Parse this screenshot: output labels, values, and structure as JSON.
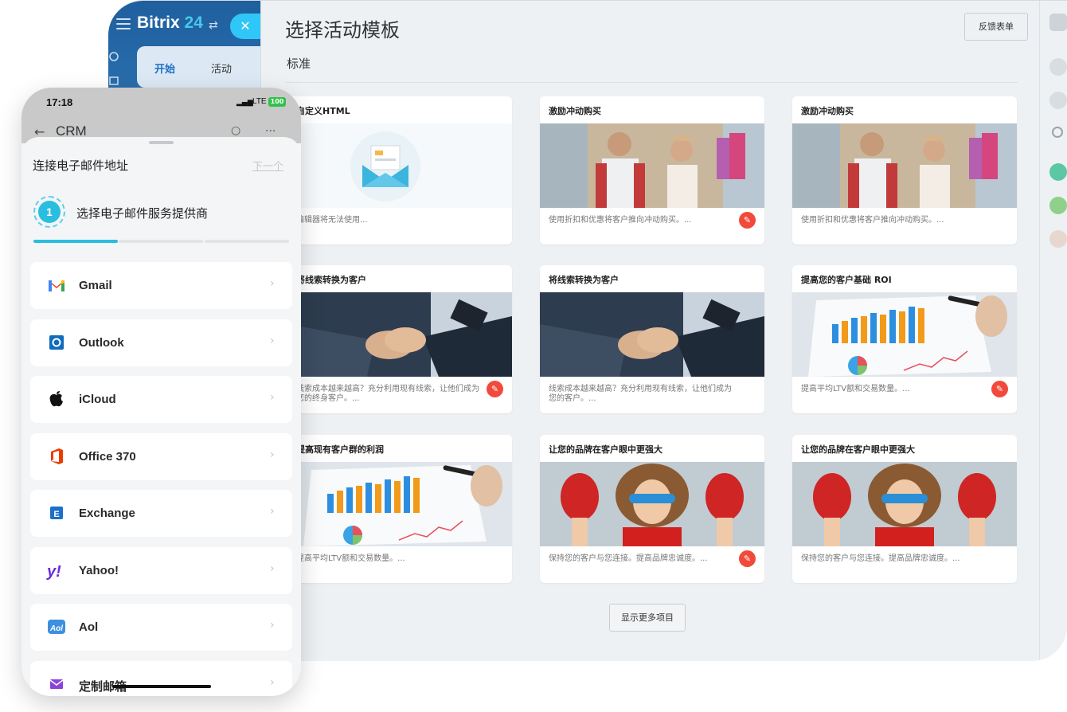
{
  "desktop": {
    "logo_text": "Bitrix",
    "logo_number": "24",
    "tabs": [
      {
        "label": "开始"
      },
      {
        "label": "活动"
      }
    ]
  },
  "panel": {
    "title": "选择活动模板",
    "feedback_label": "反馈表单",
    "section_label": "标准",
    "show_more_label": "显示更多项目",
    "cards": [
      {
        "title": "自定义HTML",
        "desc": "编辑器将无法使用...",
        "brush": false,
        "image": "mail"
      },
      {
        "title": "激励冲动购买",
        "desc": "使用折扣和优惠将客户推向冲动购买。...",
        "brush": true,
        "image": "couple"
      },
      {
        "title": "激励冲动购买",
        "desc": "使用折扣和优惠将客户推向冲动购买。...",
        "brush": false,
        "image": "couple"
      },
      {
        "title": "将线索转换为客户",
        "desc": "线索成本越来越高？充分利用现有线索，让他们成为您的终身客户。...",
        "brush": true,
        "image": "hands"
      },
      {
        "title": "将线索转换为客户",
        "desc": "线索成本越来越高？充分利用现有线索，让他们成为您的客户。...",
        "brush": false,
        "image": "hands"
      },
      {
        "title": "提高您的客户基础 ROI",
        "desc": "提高平均LTV额和交易数量。...",
        "brush": true,
        "image": "chart"
      },
      {
        "title": "提高现有客户群的利润",
        "desc": "提高平均LTV额和交易数量。...",
        "brush": false,
        "image": "chart"
      },
      {
        "title": "让您的品牌在客户眼中更强大",
        "desc": "保持您的客户与您连接。提高品牌忠诚度。...",
        "brush": true,
        "image": "kid"
      },
      {
        "title": "让您的品牌在客户眼中更强大",
        "desc": "保持您的客户与您连接。提高品牌忠诚度。...",
        "brush": false,
        "image": "kid"
      }
    ]
  },
  "phone": {
    "time": "17:18",
    "network": "LTE",
    "battery": "100",
    "app_title": "CRM",
    "sheet_title": "连接电子邮件地址",
    "next_label": "下一个",
    "step_number": "1",
    "step_label": "选择电子邮件服务提供商",
    "progress_fraction": 0.33,
    "providers": [
      {
        "name": "Gmail",
        "icon": "gmail-icon"
      },
      {
        "name": "Outlook",
        "icon": "outlook-icon"
      },
      {
        "name": "iCloud",
        "icon": "apple-icon"
      },
      {
        "name": "Office 370",
        "icon": "office-icon"
      },
      {
        "name": "Exchange",
        "icon": "exchange-icon"
      },
      {
        "name": "Yahoo!",
        "icon": "yahoo-icon"
      },
      {
        "name": "Aol",
        "icon": "aol-icon"
      },
      {
        "name": "定制邮箱",
        "icon": "mail-icon"
      }
    ]
  },
  "colors": {
    "accent": "#2fc7f7",
    "brand_blue": "#1f6fc5",
    "brush_red": "#f24a3a",
    "step_cyan": "#29bedf"
  }
}
